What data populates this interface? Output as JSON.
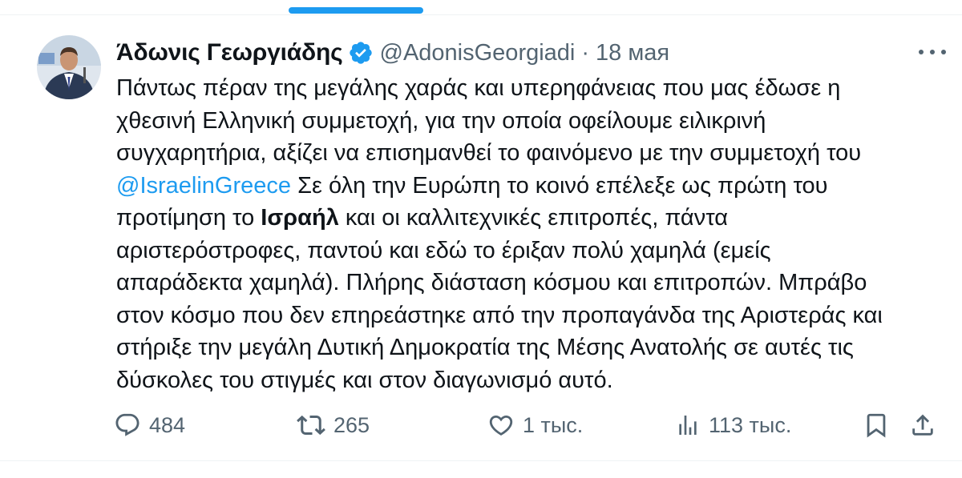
{
  "author": {
    "display_name": "Άδωνις Γεωργιάδης",
    "handle": "@AdonisGeorgiadi",
    "separator": "·",
    "date": "18 мая",
    "verified": true
  },
  "tweet": {
    "lines": [
      [
        {
          "text": "Πάντως πέραν της μεγάλης χαράς και υπερηφάνειας που μας έδωσε η",
          "style": "plain"
        }
      ],
      [
        {
          "text": "χθεσινή Ελληνική συμμετοχή, για την οποία οφείλουμε ειλικρινή",
          "style": "plain"
        }
      ],
      [
        {
          "text": "συγχαρητήρια, αξίζει να επισημανθεί το φαινόμενο με την συμμετοχή του",
          "style": "plain"
        }
      ],
      [
        {
          "text": "@IsraelinGreece",
          "style": "mention"
        },
        {
          "text": " Σε όλη την Ευρώπη το κοινό επέλεξε ως πρώτη του",
          "style": "plain"
        }
      ],
      [
        {
          "text": "προτίμηση το ",
          "style": "plain"
        },
        {
          "text": "Ισραήλ",
          "style": "bold"
        },
        {
          "text": " και οι καλλιτεχνικές επιτροπές, πάντα",
          "style": "plain"
        }
      ],
      [
        {
          "text": "αριστερόστροφες, παντού και εδώ το έριξαν πολύ χαμηλά (εμείς",
          "style": "plain"
        }
      ],
      [
        {
          "text": "απαράδεκτα χαμηλά). Πλήρης διάσταση κόσμου και επιτροπών. Μπράβο",
          "style": "plain"
        }
      ],
      [
        {
          "text": "στον κόσμο που δεν επηρεάστηκε από την προπαγάνδα της Αριστεράς και",
          "style": "plain"
        }
      ],
      [
        {
          "text": "στήριξε την μεγάλη Δυτική Δημοκρατία της Μέσης Ανατολής σε αυτές τις",
          "style": "plain"
        }
      ],
      [
        {
          "text": "δύσκολες του στιγμές και στον διαγωνισμό αυτό.",
          "style": "plain"
        }
      ]
    ]
  },
  "actions": {
    "reply": {
      "icon": "reply-icon",
      "count": "484"
    },
    "retweet": {
      "icon": "retweet-icon",
      "count": "265"
    },
    "like": {
      "icon": "heart-icon",
      "count": "1 тыс."
    },
    "views": {
      "icon": "views-chart-icon",
      "count": "113 тыс."
    },
    "bookmark": {
      "icon": "bookmark-icon"
    },
    "share": {
      "icon": "share-icon"
    }
  },
  "colors": {
    "accent": "#1d9bf0",
    "text_primary": "#0f1419",
    "text_secondary": "#536471",
    "divider": "#eff3f4"
  }
}
